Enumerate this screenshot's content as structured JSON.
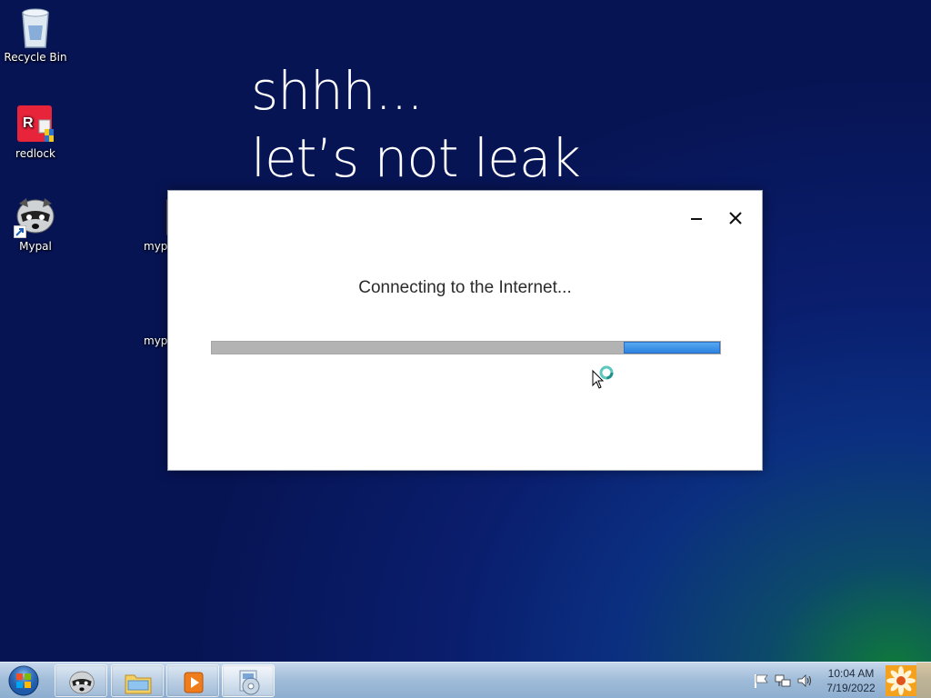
{
  "desktop": {
    "icons": [
      {
        "label": "Recycle Bin",
        "icon": "recycle-bin-icon"
      },
      {
        "label": "redlock",
        "icon": "redlock-app-icon"
      },
      {
        "label": "Mypal",
        "icon": "mypal-browser-icon"
      },
      {
        "label": "mypa",
        "icon": "folder-icon"
      },
      {
        "label": "mypa",
        "icon": "installer-icon"
      }
    ],
    "wallpaper_text": {
      "line1": "shhh...",
      "line2": "let’s not leak"
    }
  },
  "dialog": {
    "status_text": "Connecting to the Internet...",
    "progress": {
      "indeterminate": true,
      "segment_start_percent": 81,
      "segment_width_percent": 19,
      "fill_color": "#3b8de8",
      "track_color": "#b3b3b3"
    },
    "minimize_icon": "minimize-icon",
    "close_icon": "close-icon"
  },
  "taskbar": {
    "start_icon": "windows-start-orb",
    "pinned": [
      {
        "name": "Mypal",
        "icon": "mypal-browser-icon"
      },
      {
        "name": "Windows Explorer",
        "icon": "folder-icon"
      },
      {
        "name": "Windows Media Player",
        "icon": "media-player-icon"
      },
      {
        "name": "Setup",
        "icon": "installer-icon",
        "active": true
      }
    ],
    "tray": {
      "icons": [
        "action-center-flag-icon",
        "network-icon",
        "volume-icon"
      ],
      "time": "10:04 AM",
      "date": "7/19/2022"
    }
  },
  "colors": {
    "desktop_background": "#0a1e6e",
    "taskbar": "#a9c3de",
    "progress_fill": "#3b8de8"
  }
}
